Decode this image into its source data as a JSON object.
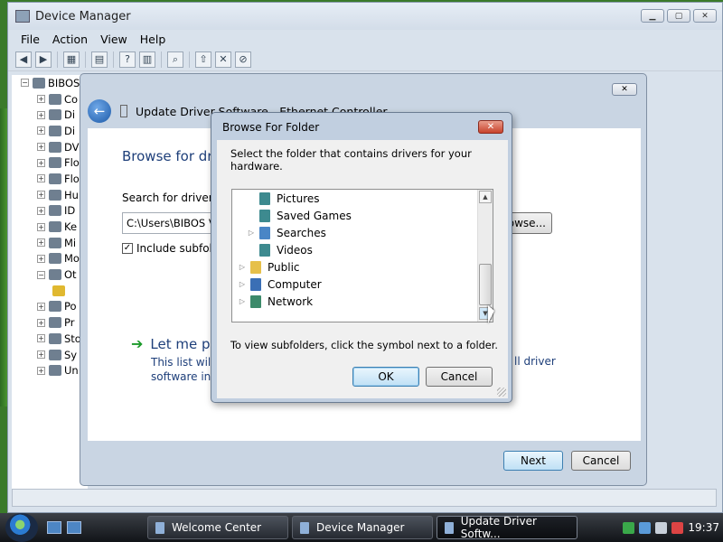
{
  "device_manager": {
    "title": "Device Manager",
    "menu": [
      "File",
      "Action",
      "View",
      "Help"
    ],
    "tree_root": "BIBOS",
    "tree_items": [
      "Co",
      "Di",
      "Di",
      "DV",
      "Flo",
      "Flo",
      "Hu",
      "ID",
      "Ke",
      "Mi",
      "Mo",
      "Ot",
      "",
      "Po",
      "Pr",
      "Sto",
      "Sy",
      "Un"
    ]
  },
  "wizard": {
    "title": "Update Driver Software - Ethernet Controller",
    "heading": "Browse for dri",
    "search_label": "Search for driver so",
    "path_value": "C:\\Users\\BIBOS VI",
    "browse_label": "Browse...",
    "include_subfolders": "Include subfold",
    "let_me_pick": "Let me pic",
    "description": "This list will s",
    "description_line2": "software in t",
    "description_right": "ll driver",
    "next": "Next",
    "cancel": "Cancel"
  },
  "browse_dialog": {
    "title": "Browse For Folder",
    "instruction": "Select the folder that contains drivers for your hardware.",
    "folders": [
      {
        "name": "Pictures",
        "expandable": false,
        "color": "#3d8a8f"
      },
      {
        "name": "Saved Games",
        "expandable": false,
        "color": "#3d8a8f"
      },
      {
        "name": "Searches",
        "expandable": true,
        "color": "#4a86c6"
      },
      {
        "name": "Videos",
        "expandable": false,
        "color": "#3d8a8f"
      },
      {
        "name": "Public",
        "expandable": true,
        "color": "#e6c04a"
      },
      {
        "name": "Computer",
        "expandable": true,
        "color": "#3a6fb5"
      },
      {
        "name": "Network",
        "expandable": true,
        "color": "#3c8a6a"
      }
    ],
    "hint": "To view subfolders, click the symbol next to a folder.",
    "ok": "OK",
    "cancel": "Cancel"
  },
  "taskbar": {
    "items": [
      "Welcome Center",
      "Device Manager",
      "Update Driver Softw..."
    ],
    "active_index": 2,
    "clock": "19:37"
  }
}
